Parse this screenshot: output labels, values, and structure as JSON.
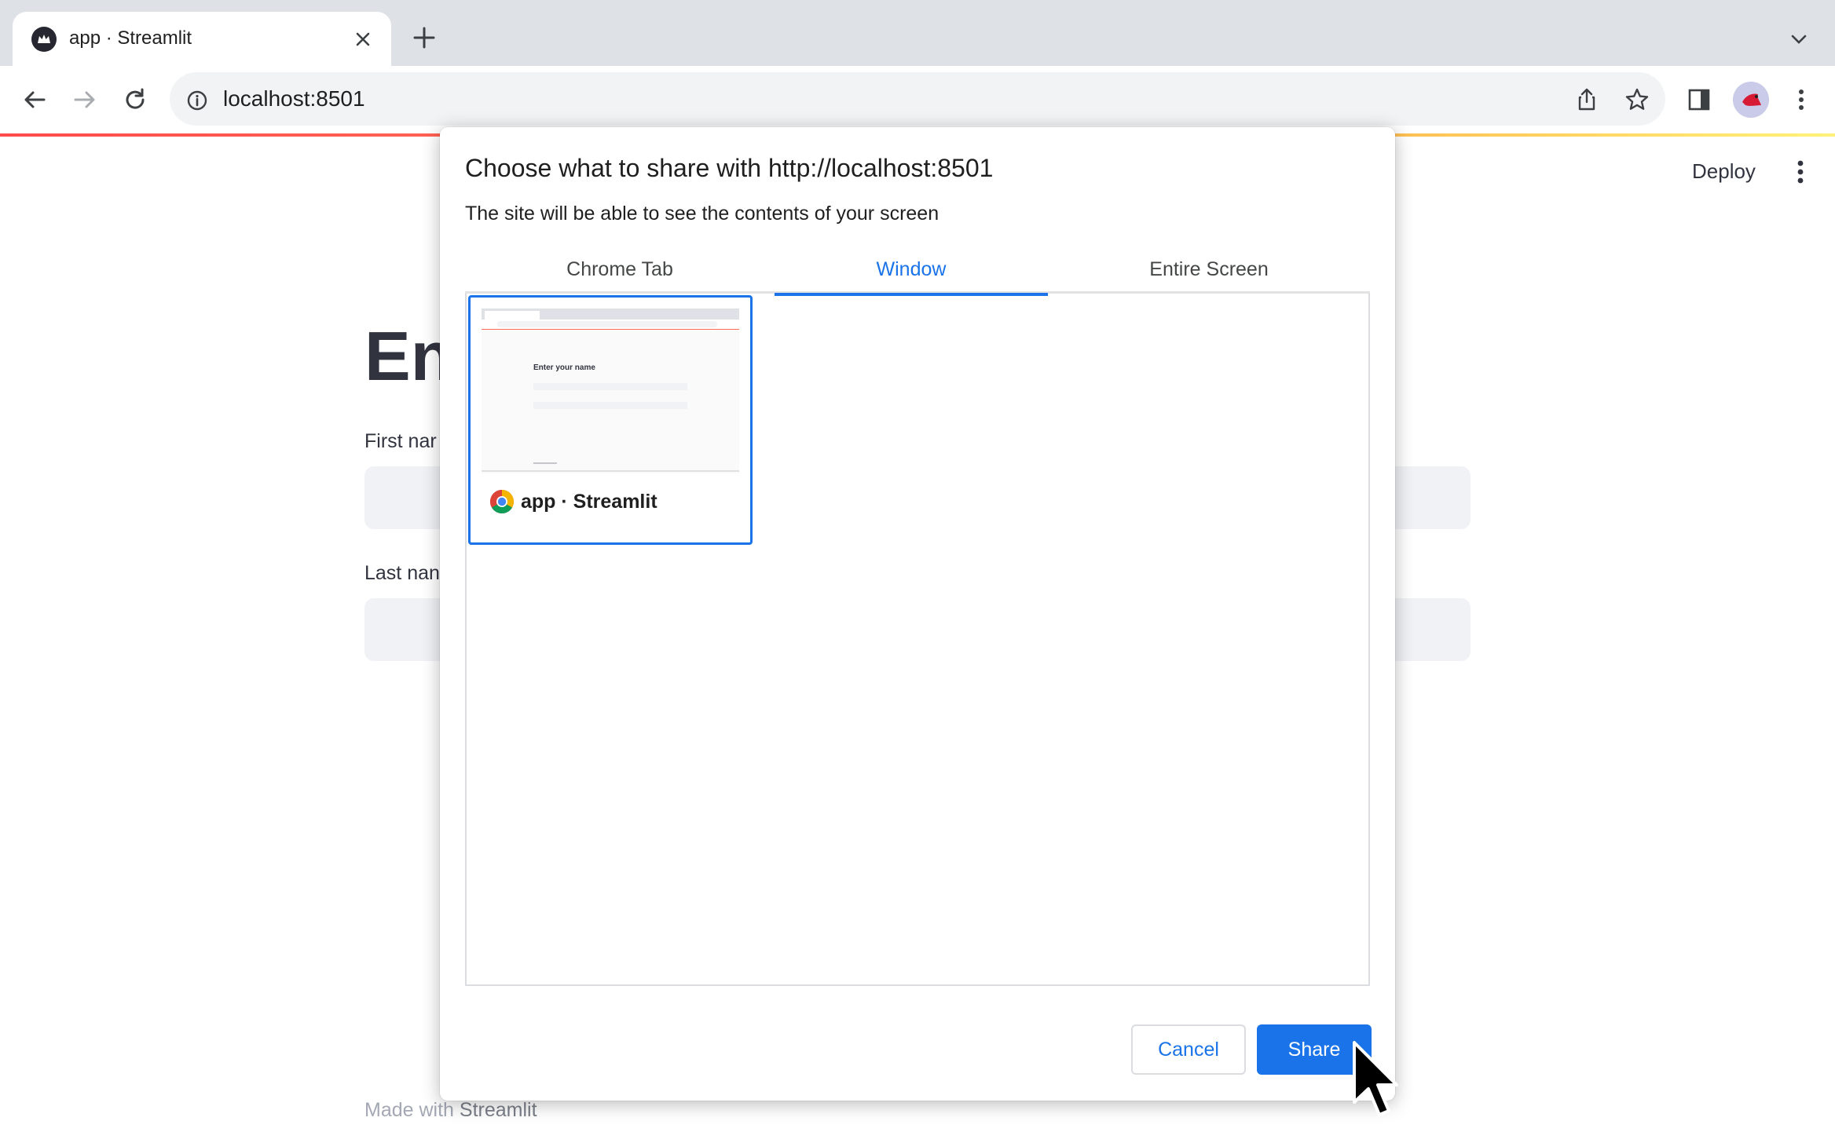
{
  "browser": {
    "tab_title": "app · Streamlit",
    "url": "localhost:8501"
  },
  "page": {
    "deploy_label": "Deploy",
    "title_visible": "En",
    "first_name_label": "First nar",
    "last_name_label": "Last nan",
    "footer_prefix": "Made with ",
    "footer_brand": "Streamlit"
  },
  "dialog": {
    "title": "Choose what to share with http://localhost:8501",
    "subtitle": "The site will be able to see the contents of your screen",
    "tabs": [
      {
        "label": "Chrome Tab",
        "active": false
      },
      {
        "label": "Window",
        "active": true
      },
      {
        "label": "Entire Screen",
        "active": false
      }
    ],
    "sources": [
      {
        "label": "app · Streamlit",
        "selected": true,
        "thumbnail_heading": "Enter your name"
      }
    ],
    "cancel_label": "Cancel",
    "share_label": "Share"
  },
  "colors": {
    "accent": "#1a73e8",
    "streamlit_red": "#ff4b4b",
    "input_bg": "#f0f2f6"
  },
  "icons": [
    "streamlit-favicon",
    "close-icon",
    "plus-icon",
    "chevron-down-icon",
    "back-arrow-icon",
    "forward-arrow-icon",
    "reload-icon",
    "info-icon",
    "share-icon",
    "star-icon",
    "side-panel-icon",
    "profile-avatar",
    "more-vert-icon",
    "chrome-icon",
    "mouse-cursor"
  ]
}
